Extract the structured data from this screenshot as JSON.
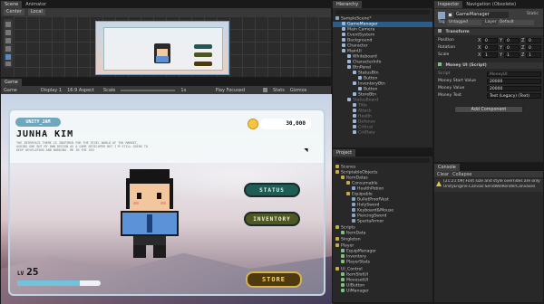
{
  "scene": {
    "tab": "Scene",
    "tab2": "Animator",
    "tool_center": "Center",
    "tool_local": "Local"
  },
  "game": {
    "tab": "Game",
    "mode": "Game",
    "display": "Display 1",
    "aspect": "16:9 Aspect",
    "scale_label": "Scale",
    "scale_value": "1x",
    "play_focused": "Play Focused",
    "stats": "Stats",
    "gizmos": "Gizmos"
  },
  "ui": {
    "badge": "UNITY_JAM",
    "name": "JUNHA KIM",
    "description": "THE INTERFACE THEME IS INSPIRED FOR THE PIXEL WORLD OF THE MARKET, ASKING ONE BUT MY OWN DESIGN AS A GAME DEVELOPER BUT I'M STILL GOING TO KEEP DEVELOPING AND WORKING. ME IN THE 2D3",
    "gold": "30,000",
    "btn_status": "STATUS",
    "btn_inventory": "INVENTORY",
    "btn_store": "STORE",
    "level_prefix": "LV",
    "level": "25",
    "xp_fraction": 0.75
  },
  "hierarchy": {
    "title": "Hierarchy",
    "items": [
      {
        "label": "SampleScene*"
      },
      {
        "label": "GameManager"
      },
      {
        "label": "Main Camera"
      },
      {
        "label": "EventSystem"
      },
      {
        "label": "Background"
      },
      {
        "label": "Character"
      },
      {
        "label": "MainUI"
      },
      {
        "label": "Whiteboard"
      },
      {
        "label": "CharacterInfo"
      },
      {
        "label": "BtnPanel"
      },
      {
        "label": "StatusBtn"
      },
      {
        "label": "Button"
      },
      {
        "label": "InventoryBtn"
      },
      {
        "label": "Button"
      },
      {
        "label": "StoreBtn"
      },
      {
        "label": "StatusBoard"
      },
      {
        "label": "Title"
      },
      {
        "label": "Attack"
      },
      {
        "label": "Health"
      },
      {
        "label": "Defense"
      },
      {
        "label": "Critical"
      },
      {
        "label": "CritRate"
      }
    ]
  },
  "project": {
    "title": "Project",
    "folders": [
      {
        "label": "Scenes"
      },
      {
        "label": "ScriptableObjects"
      },
      {
        "label": "ItemDatas"
      },
      {
        "label": "Consumable"
      },
      {
        "label": "HealthPotion"
      },
      {
        "label": "Equipable"
      },
      {
        "label": "BulletProofVest"
      },
      {
        "label": "HolySword"
      },
      {
        "label": "Keyboard&Mouse"
      },
      {
        "label": "PiercingSword"
      },
      {
        "label": "SpartaArmor"
      },
      {
        "label": "Scripts"
      },
      {
        "label": "ItemData"
      },
      {
        "label": "Singleton"
      },
      {
        "label": "Player"
      },
      {
        "label": "EquipManager"
      },
      {
        "label": "Inventory"
      },
      {
        "label": "PlayerStats"
      },
      {
        "label": "UI_Control"
      },
      {
        "label": "ItemSlotUI"
      },
      {
        "label": "MovesetUI"
      },
      {
        "label": "UIButton"
      },
      {
        "label": "UIManager"
      }
    ]
  },
  "inspector": {
    "tab": "Inspector",
    "tab2": "Navigation (Obsolete)",
    "object_name": "GameManager",
    "static_label": "Static",
    "tag_label": "Tag",
    "tag_value": "Untagged",
    "layer_label": "Layer",
    "layer_value": "Default",
    "transform_title": "Transform",
    "position_label": "Position",
    "rotation_label": "Rotation",
    "scale_label": "Scale",
    "axis_x": "X",
    "axis_y": "Y",
    "axis_z": "Z",
    "zero": "0",
    "one": "1",
    "script_title": "Money UI (Script)",
    "script_label": "Script",
    "script_value": "MoneyUI",
    "money_start_label": "Money Start Value",
    "money_start_value": "20000",
    "money_value_label": "Money Value",
    "money_value_value": "20000",
    "money_text_label": "Money Text",
    "money_text_value": "Text (Legacy) (Text)",
    "add_component": "Add Component"
  },
  "console": {
    "tab": "Console",
    "clear": "Clear",
    "collapse": "Collapse",
    "message1": "[21:21:09] Font size and style overrides are only",
    "message2": "UnityEngine.Canvas:SendWillRenderCanvases"
  }
}
